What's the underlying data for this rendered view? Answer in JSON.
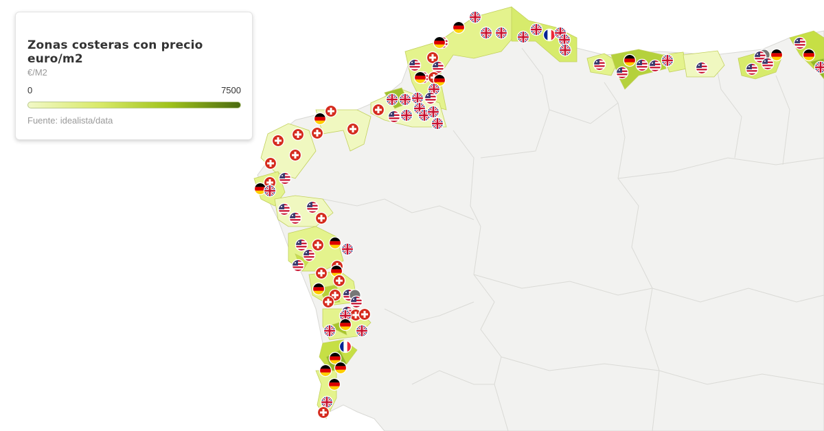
{
  "legend": {
    "title": "Zonas costeras con precio euro/m2",
    "unit": "€/M2",
    "min_label": "0",
    "max_label": "7500",
    "source": "Fuente: idealista/data",
    "gradient_colors": [
      "#f1f8c6",
      "#d9ea6a",
      "#9fc21b",
      "#4b6b10"
    ]
  },
  "map": {
    "land_color": "#f2f2f0",
    "border_color": "#dcdcd8",
    "sea_color": "#ffffff",
    "marker_types": {
      "uk": "united-kingdom-flag-icon",
      "us": "united-states-flag-icon",
      "de": "germany-flag-icon",
      "ch": "switzerland-flag-icon",
      "fr": "france-flag-icon",
      "gray": "gray-dot-marker"
    }
  }
}
